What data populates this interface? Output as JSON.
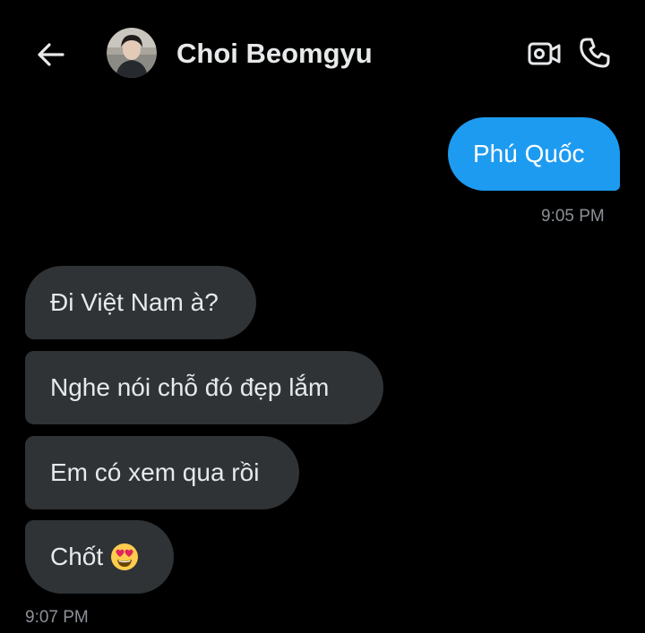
{
  "header": {
    "contact_name": "Choi Beomgyu",
    "back_icon": "arrow-left-icon",
    "video_icon": "video-call-icon",
    "call_icon": "phone-icon"
  },
  "messages": {
    "sent": [
      {
        "text": "Phú Quốc"
      }
    ],
    "sent_time": "9:05 PM",
    "received": [
      {
        "text": "Đi Việt Nam à?"
      },
      {
        "text": "Nghe nói chỗ đó đẹp lắm"
      },
      {
        "text": "Em có xem qua rồi"
      },
      {
        "text": "Chốt",
        "emoji": "heart-eyes-emoji"
      }
    ],
    "received_time": "9:07 PM"
  },
  "colors": {
    "background": "#000000",
    "sent_bubble": "#1d9bf0",
    "received_bubble": "#2f3336",
    "text": "#e7e9ea",
    "timestamp": "#8b9197"
  }
}
